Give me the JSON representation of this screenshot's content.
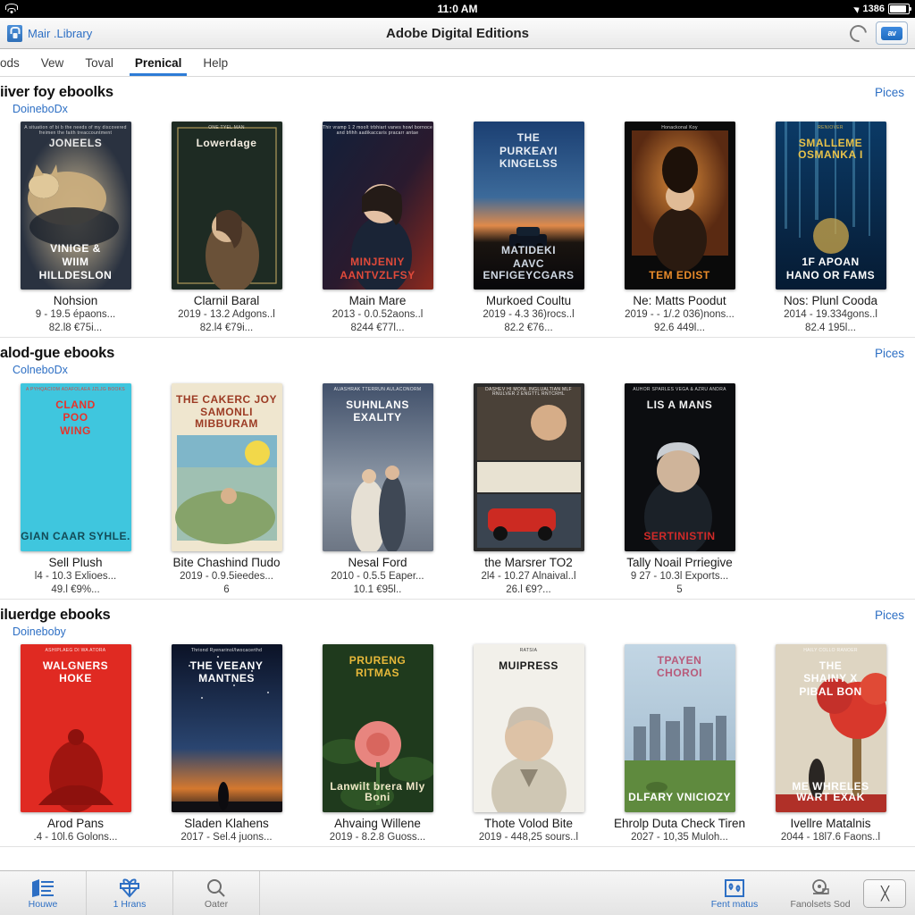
{
  "statusbar": {
    "time": "11:0 AM",
    "battery_text": "1386",
    "wifi_icon": "wifi-icon",
    "location_icon": "location-arrow-icon",
    "battery_icon": "battery-icon"
  },
  "titlebar": {
    "library_link": "Mair .Library",
    "title": "Adobe Digital Editions",
    "lock_icon": "lock-badge-icon",
    "refresh_icon": "refresh-icon",
    "sync_label": "av"
  },
  "menubar": {
    "items": [
      {
        "label": "ods",
        "active": false
      },
      {
        "label": "Vew",
        "active": false
      },
      {
        "label": "Toval",
        "active": false
      },
      {
        "label": "Prenical",
        "active": true
      },
      {
        "label": "Help",
        "active": false
      }
    ]
  },
  "shelves": [
    {
      "title": "iiver foy eboolks",
      "subtitle": "DoineboDx",
      "more": "Pices",
      "books": [
        {
          "title": "Nohsion",
          "line2": "9 - 19.5 épaons...",
          "line3": "82.l8 €75i...",
          "cover": {
            "bg": "linear-gradient(#17202b,#2c3742)",
            "top": "JONEELS",
            "topcolor": "#e8e8e8",
            "topsize": "13px",
            "bottom": "VINIGE &\nWIIM\nHILLDESLON",
            "bottomcolor": "#ffffff",
            "blurb": "A situation of bi b the needs of my discovered freimen the faith treaccountment",
            "art": "cat"
          }
        },
        {
          "title": "Clarnil Baral",
          "line2": "2019 - 13.2 Adgons..l",
          "line3": "82.l4 €79i...",
          "cover": {
            "bg": "linear-gradient(#223029,#1b2820)",
            "top": "Lowerdage",
            "topcolor": "#f2ece0",
            "topsize": "16px",
            "bottom": "",
            "bottomcolor": "#d8cfbc",
            "blurb": "ONE TYEL MAN",
            "art": "woman-green"
          }
        },
        {
          "title": "Main Mare",
          "line2": "2013 - 0.0.52aons..l",
          "line3": "8244 €77l...",
          "cover": {
            "bg": "linear-gradient(120deg,#141c2e,#3a1520)",
            "top": "",
            "topcolor": "#ffffff",
            "topsize": "11px",
            "bottom": "MINJENIY\nAANTVZLFSY",
            "bottomcolor": "#e04a3a",
            "blurb": "Thir vramp 1 2 moolt trbhiart vanes howl bornoce and bfihh aadikaccaris pracarr antae",
            "art": "woman-face"
          }
        },
        {
          "title": "Murkoed Coultu",
          "line2": "2019 - 4.3 36)rocs..l",
          "line3": "82.2 €76...",
          "cover": {
            "bg": "linear-gradient(#1b3f72,#0d1b2a 58%,#0a0a0a)",
            "top": "THE\nPURKEAYI\nKINGELSS",
            "topcolor": "#e9eef5",
            "topsize": "12px",
            "bottom": "MATIDEKI\nAAVC ENFIGEYCGARS",
            "bottomcolor": "#cfd8e3",
            "blurb": "",
            "art": "car-road"
          }
        },
        {
          "title": "Ne: Matts Poodut",
          "line2": "2019 - - 1/.2 036)nons...",
          "line3": "92.6 449l...",
          "cover": {
            "bg": "#0a0a0a",
            "top": "",
            "topcolor": "#fff",
            "topsize": "10px",
            "bottom": "TEM EDIST",
            "bottomcolor": "#e98b2a",
            "blurb": "Honackonal Koy",
            "art": "portrait-orange"
          }
        },
        {
          "title": "Nos: Plunl Cooda",
          "line2": "2014 - 19.334gons..l",
          "line3": "82.4 195l...",
          "cover": {
            "bg": "linear-gradient(#0b2a52,#09213f)",
            "top": "SMALLEME OSMANKA I",
            "topcolor": "#e8c24a",
            "topsize": "9px",
            "bottom": "1F APOAN\nHANO OR FAMS",
            "bottomcolor": "#ffffff",
            "blurb": "RENIOVER",
            "art": "blue-waves"
          }
        }
      ]
    },
    {
      "title": "alod-gue ebooks",
      "subtitle": "ColneboDx",
      "more": "Pices",
      "books": [
        {
          "title": "Sell Plush",
          "line2": "l4 - 10.3 Exlioes...",
          "line3": "49.l €9%...",
          "cover": {
            "bg": "#3fc6de",
            "top": "CLAND\nPOO\nWING",
            "topcolor": "#e8332a",
            "topsize": "21px",
            "bottom": "GIAN CAAR SYHLE.",
            "bottomcolor": "#134b57",
            "blurb": "A PYHQACIOM ADAFOLAEA JZLJG BOOKS",
            "art": "flat-teal"
          }
        },
        {
          "title": "Bite Chashind Пudo",
          "line2": "2019 - 0.9.5ieedes...",
          "line3": "6",
          "cover": {
            "bg": "#efe6cf",
            "top": "THE CAKERC JOY\nSAMONLI MIBBURAM",
            "topcolor": "#9c3b24",
            "topsize": "9px",
            "bottom": "",
            "bottomcolor": "#5a4634",
            "blurb": "",
            "art": "travel-photo"
          }
        },
        {
          "title": "Nesal Ford",
          "line2": "2010 - 0.5.5 Eaper...",
          "line3": "10.1 €95l..",
          "cover": {
            "bg": "linear-gradient(#41506a,#8d98a6)",
            "top": "SUHNLANS\nEXALITY",
            "topcolor": "#ffffff",
            "topsize": "14px",
            "bottom": "",
            "bottomcolor": "#ffffff",
            "blurb": "AUASHRAK TTERRUN AULACONORM",
            "art": "couple-road"
          }
        },
        {
          "title": "the Marsrer TO2",
          "line2": "2l4 - 10.27 Alnaival..l",
          "line3": "26.l €9?...",
          "cover": {
            "bg": "#2b2b2b",
            "top": "",
            "topcolor": "#fff",
            "topsize": "10px",
            "bottom": "",
            "bottomcolor": "#fff",
            "blurb": "DASHEV HI MONL INGLUALTIAN MLF RNULVER 2 ENGTTL RNTCRHL",
            "art": "man-car"
          }
        },
        {
          "title": "Tally Noail Prriegive",
          "line2": "9 27 - 10.3l Exports...",
          "line3": "5",
          "cover": {
            "bg": "#0c0d10",
            "top": "LIS A MANS",
            "topcolor": "#f2f2f2",
            "topsize": "16px",
            "bottom": "SERTINISTIN",
            "bottomcolor": "#d12a28",
            "blurb": "AUHOR SPARLES VEGA & AZRU ANDRA",
            "art": "man-portrait"
          }
        }
      ]
    },
    {
      "title": "iluerdge ebooks",
      "subtitle": "Doineboby",
      "more": "Pices",
      "books": [
        {
          "title": "Arod Pans",
          "line2": ".4 - 10l.6 Golons...",
          "line3": "",
          "cover": {
            "bg": "#e02a22",
            "top": "WALGNERS\nHOKE",
            "topcolor": "#ffffff",
            "topsize": "17px",
            "bottom": "",
            "bottomcolor": "#ffffff",
            "blurb": "ASHIPLAEG DI WA ATORA",
            "art": "red-figure"
          }
        },
        {
          "title": "Sladen Klahens",
          "line2": "2017 - Sel.4 juons...",
          "line3": "",
          "cover": {
            "bg": "linear-gradient(#101a33,#24375c 55%,#c56a3a)",
            "top": "THE VEEANY\nMANTNES",
            "topcolor": "#ffffff",
            "topsize": "13px",
            "bottom": "",
            "bottomcolor": "#ffffff",
            "blurb": "Thriond Ryenarinol/lwocacerthd",
            "art": "night-sky"
          }
        },
        {
          "title": "Ahvaing Willene",
          "line2": "2019 - 8.2.8 Guoss...",
          "line3": "",
          "cover": {
            "bg": "#1f3a1d",
            "top": "PRURENG\nRITMAS",
            "topcolor": "#e8b93a",
            "topsize": "17px",
            "bottom": "Lanwilt brera Mly Boni",
            "bottomcolor": "#f0e8c8",
            "blurb": "",
            "art": "flower"
          }
        },
        {
          "title": "Thote Volod Bite",
          "line2": "2019 - 448,25 sours..l",
          "line3": "",
          "cover": {
            "bg": "#f2f0ea",
            "top": "MUIPRESS",
            "topcolor": "#1a1a1a",
            "topsize": "17px",
            "bottom": "",
            "bottomcolor": "#333333",
            "blurb": "RATSIA",
            "art": "man-bw"
          }
        },
        {
          "title": "Ehrolp Duta Check Tiren",
          "line2": "2027 - 10,35 Muloh...",
          "line3": "",
          "cover": {
            "bg": "#b9cfe0",
            "top": "TPAYEN\nCHOROI",
            "topcolor": "#b85a7a",
            "topsize": "17px",
            "bottom": "DLFARY VNICIOZY",
            "bottomcolor": "#ffffff",
            "blurb": "",
            "art": "city-field"
          }
        },
        {
          "title": "Ivellre Matalnis",
          "line2": "2044 - 18l7.6 Faons..l",
          "line3": "",
          "cover": {
            "bg": "#ded5c2",
            "top": "THE\nSHAINY X\nPIBAL BON",
            "topcolor": "#ffffff",
            "topsize": "13px",
            "bottom": "ME WHRELES WART EXAK",
            "bottomcolor": "#ffffff",
            "blurb": "HAILY COLLO RANOER",
            "art": "red-tree"
          }
        }
      ]
    }
  ],
  "toolbar": {
    "left": [
      {
        "label": "Houwe",
        "icon": "library-icon",
        "active": true
      },
      {
        "label": "1 Hrans",
        "icon": "gift-box-icon",
        "active": true
      },
      {
        "label": "Oater",
        "icon": "search-icon",
        "active": false
      }
    ],
    "right": [
      {
        "label": "Fent matus",
        "icon": "bookmark-panel-icon",
        "active": true
      },
      {
        "label": "Fanolsets Sod",
        "icon": "settings-dial-icon",
        "active": false
      }
    ],
    "close_label": "╳",
    "close_icon": "close-x-icon"
  },
  "colors": {
    "accent": "#2d6fc4",
    "tab_underline": "#2d7cd6",
    "statusbar_bg": "#000000"
  }
}
